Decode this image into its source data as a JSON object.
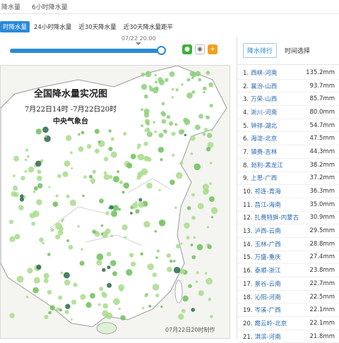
{
  "top_tabs": [
    "降水量",
    "6小时降水量"
  ],
  "sub_tabs": [
    "时降水量",
    "24小时降水量",
    "近30天降水量",
    "近30天降水量距平"
  ],
  "active_sub_tab": 0,
  "slider": {
    "time": "07/22 20:00",
    "progress": 1.0
  },
  "share_icons": [
    "wechat-icon",
    "eye-icon",
    "plus-icon"
  ],
  "map": {
    "title": "全国降水量实况图",
    "date": "7月22日14时 -7月22日20时",
    "org": "中央气象台",
    "footer": "07月22日20时制作"
  },
  "panel": {
    "tabs": [
      "降水排行",
      "时间选择"
    ],
    "ranking": [
      {
        "n": "1.",
        "station": "西峡-河南",
        "value": "135.2mm"
      },
      {
        "n": "2.",
        "station": "襄汾-山西",
        "value": "93.7mm"
      },
      {
        "n": "3.",
        "station": "万荣-山西",
        "value": "85.7mm"
      },
      {
        "n": "4.",
        "station": "淅川-河南",
        "value": "80.0mm"
      },
      {
        "n": "5.",
        "station": "钟祥-湖北",
        "value": "54.7mm"
      },
      {
        "n": "6.",
        "station": "海淀-北京",
        "value": "47.5mm"
      },
      {
        "n": "7.",
        "station": "镇赉-吉林",
        "value": "44.3mm"
      },
      {
        "n": "8.",
        "station": "勃利-黑龙江",
        "value": "38.2mm"
      },
      {
        "n": "9.",
        "station": "上思-广西",
        "value": "37.2mm"
      },
      {
        "n": "10.",
        "station": "祁连-青海",
        "value": "36.3mm"
      },
      {
        "n": "11.",
        "station": "昌江-海南",
        "value": "35.0mm"
      },
      {
        "n": "12.",
        "station": "扎赉特旗-内蒙古",
        "value": "30.9mm"
      },
      {
        "n": "13.",
        "station": "泸西-云南",
        "value": "29.5mm"
      },
      {
        "n": "14.",
        "station": "玉林-广西",
        "value": "28.8mm"
      },
      {
        "n": "15.",
        "station": "万盛-重庆",
        "value": "27.4mm"
      },
      {
        "n": "16.",
        "station": "泰顺-浙江",
        "value": "23.8mm"
      },
      {
        "n": "17.",
        "station": "景谷-云南",
        "value": "22.7mm"
      },
      {
        "n": "18.",
        "station": "沁阳-河南",
        "value": "22.5mm"
      },
      {
        "n": "19.",
        "station": "岑溪-广西",
        "value": "22.1mm"
      },
      {
        "n": "20.",
        "station": "霞云岭-北京",
        "value": "22.1mm"
      },
      {
        "n": "21.",
        "station": "淇滨-河南",
        "value": "21.8mm"
      }
    ]
  }
}
